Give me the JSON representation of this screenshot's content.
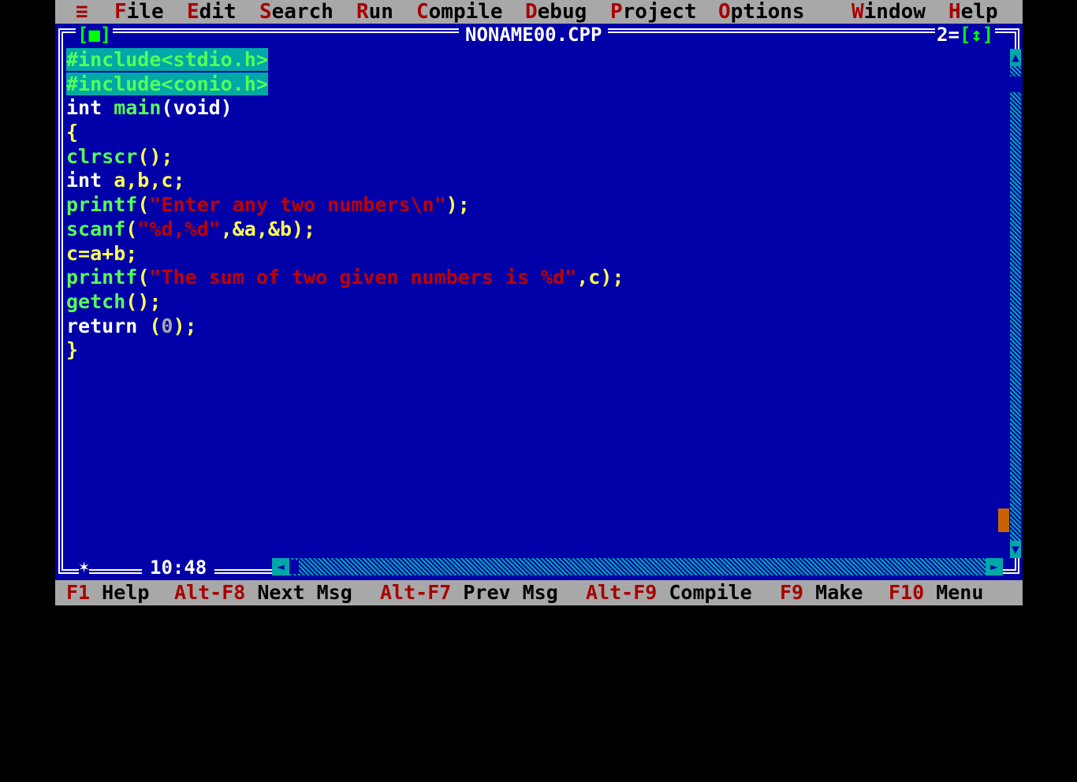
{
  "menu": {
    "system": "≡",
    "items": [
      {
        "hot": "F",
        "rest": "ile"
      },
      {
        "hot": "E",
        "rest": "dit"
      },
      {
        "hot": "S",
        "rest": "earch"
      },
      {
        "hot": "R",
        "rest": "un"
      },
      {
        "hot": "C",
        "rest": "ompile"
      },
      {
        "hot": "D",
        "rest": "ebug"
      },
      {
        "hot": "P",
        "rest": "roject"
      },
      {
        "hot": "O",
        "rest": "ptions"
      },
      {
        "hot": "W",
        "rest": "indow"
      },
      {
        "hot": "H",
        "rest": "elp"
      }
    ]
  },
  "window": {
    "title": "NONAME00.CPP",
    "close_box": "[■]",
    "number": "2",
    "zoom_box": "[↕]",
    "cursor_pos": "10:48",
    "resize_glyph": "✶"
  },
  "code": {
    "l1": "#include<stdio.h>",
    "l2": "#include<conio.h>",
    "l3a": "int",
    "l3b": " main",
    "l3c": "(void)",
    "l4": "{",
    "l5a": "clrscr",
    "l5b": "();",
    "l6a": "int",
    "l6b": " a,b,c;",
    "l7a": "printf",
    "l7b": "(",
    "l7c": "\"Enter any two numbers\\n\"",
    "l7d": ");",
    "l8a": "scanf",
    "l8b": "(",
    "l8c": "\"%d,%d\"",
    "l8d": ",&a,&b);",
    "l9a": "c=a+b;",
    "l10a": "printf",
    "l10b": "(",
    "l10c": "\"The sum of two given numbers is %d\"",
    "l10d": ",c);",
    "l11a": "getch",
    "l11b": "();",
    "l12a": "return",
    "l12b": " (",
    "l12c": "0",
    "l12d": ");",
    "l13": "}"
  },
  "status": {
    "items": [
      {
        "key": "F1",
        "label": " Help"
      },
      {
        "key": "Alt-F8",
        "label": " Next Msg"
      },
      {
        "key": "Alt-F7",
        "label": " Prev Msg"
      },
      {
        "key": "Alt-F9",
        "label": " Compile"
      },
      {
        "key": "F9",
        "label": " Make"
      },
      {
        "key": "F10",
        "label": " Menu"
      }
    ]
  },
  "colors": {
    "editor_bg": "#0000a8",
    "menu_bg": "#a8a8a8",
    "hotkey": "#a80000",
    "selection": "#00a8a8",
    "string": "#c00000",
    "function": "#55ff55"
  }
}
